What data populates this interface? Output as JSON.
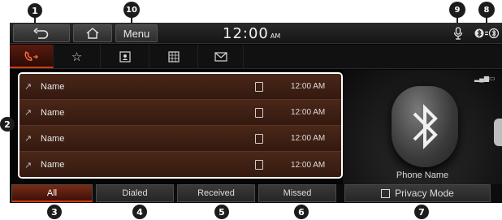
{
  "topbar": {
    "back_icon": "back-arrow-icon",
    "home_icon": "home-icon",
    "menu_label": "Menu",
    "clock_time": "12:00",
    "clock_ampm": "AM",
    "mic_icon": "microphone-icon",
    "bt_icon": "bluetooth-connection-icon"
  },
  "tabs": [
    {
      "icon": "call-history-icon"
    },
    {
      "icon": "star-icon"
    },
    {
      "icon": "contacts-icon"
    },
    {
      "icon": "keypad-icon"
    },
    {
      "icon": "message-icon"
    }
  ],
  "call_list": [
    {
      "name": "Name",
      "time": "12:00 AM"
    },
    {
      "name": "Name",
      "time": "12:00 AM"
    },
    {
      "name": "Name",
      "time": "12:00 AM"
    },
    {
      "name": "Name",
      "time": "12:00 AM"
    }
  ],
  "device": {
    "phone_name": "Phone Name"
  },
  "bottom": {
    "all_label": "All",
    "dialed_label": "Dialed",
    "received_label": "Received",
    "missed_label": "Missed",
    "privacy_label": "Privacy Mode"
  },
  "callouts": {
    "c1": "1",
    "c2": "2",
    "c3": "3",
    "c4": "4",
    "c5": "5",
    "c6": "6",
    "c7": "7",
    "c8": "8",
    "c9": "9",
    "c10": "10"
  }
}
